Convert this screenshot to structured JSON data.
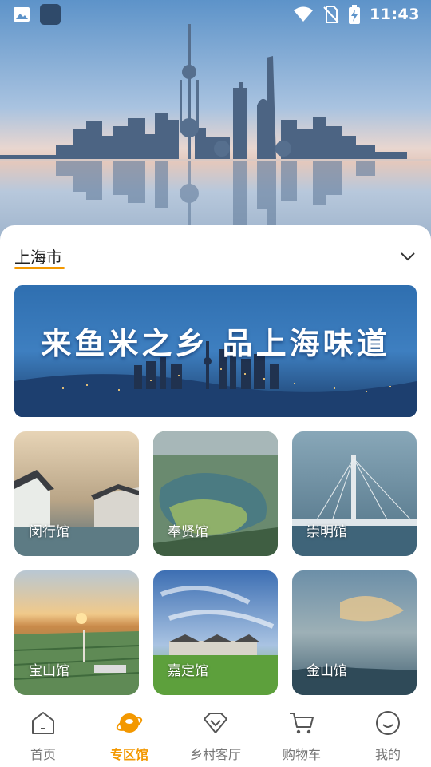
{
  "status_bar": {
    "time": "11:43",
    "left_icons": [
      "gallery-icon",
      "app-square-icon"
    ],
    "right_icons": [
      "wifi-icon",
      "no-sim-icon",
      "battery-charging-icon"
    ]
  },
  "hero": {
    "image": "shanghai-skyline-reflection"
  },
  "city_selector": {
    "label": "上海市",
    "icon": "chevron-down-icon",
    "accent": "#F39800"
  },
  "banner": {
    "text": "来鱼米之乡  品上海味道",
    "image": "shanghai-night-riverfront"
  },
  "pavilions": [
    {
      "label": "闵行馆",
      "image": "water-town-canal"
    },
    {
      "label": "奉贤馆",
      "image": "aerial-park-lake"
    },
    {
      "label": "崇明馆",
      "image": "cable-stayed-bridge"
    },
    {
      "label": "宝山馆",
      "image": "sunset-farmland"
    },
    {
      "label": "嘉定馆",
      "image": "green-field-houses"
    },
    {
      "label": "金山馆",
      "image": "cloudy-sky-sea"
    }
  ],
  "bottom_nav": {
    "items": [
      {
        "label": "首页",
        "icon": "home-icon",
        "active": false
      },
      {
        "label": "专区馆",
        "icon": "planet-icon",
        "active": true
      },
      {
        "label": "乡村客厅",
        "icon": "diamond-icon",
        "active": false
      },
      {
        "label": "购物车",
        "icon": "cart-icon",
        "active": false
      },
      {
        "label": "我的",
        "icon": "smiley-icon",
        "active": false
      }
    ],
    "active_color": "#F39800",
    "inactive_color": "#777777"
  }
}
